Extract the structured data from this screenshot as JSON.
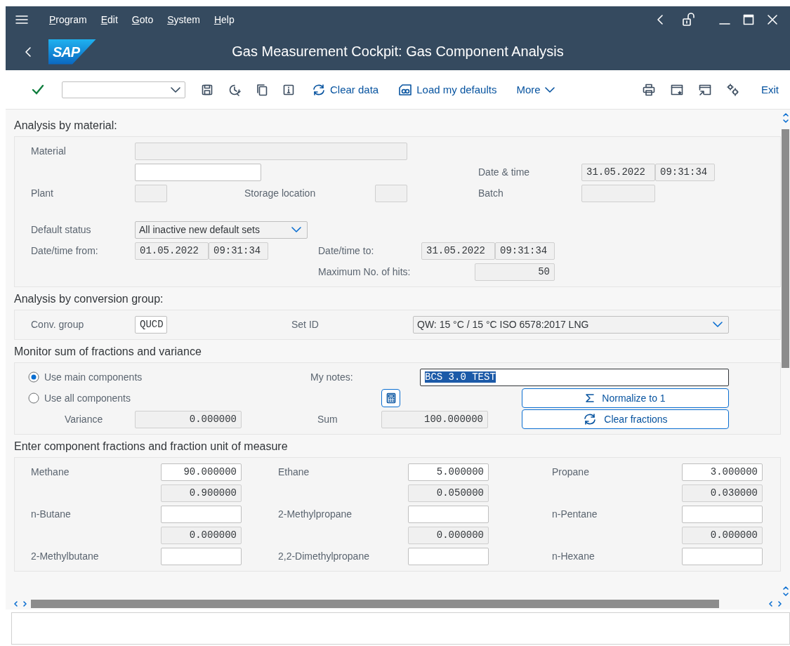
{
  "menu_bar": {
    "items": [
      {
        "label": "Program"
      },
      {
        "label": "Edit"
      },
      {
        "label": "Goto"
      },
      {
        "label": "System"
      },
      {
        "label": "Help"
      }
    ]
  },
  "title_bar": {
    "logo": "SAP",
    "title": "Gas Measurement Cockpit: Gas Component Analysis"
  },
  "toolbar": {
    "buttons": [
      {
        "label": "Clear data"
      },
      {
        "label": "Load my defaults"
      },
      {
        "label": "More"
      }
    ],
    "exit": "Exit"
  },
  "sections": [
    {
      "title": "Analysis by material:",
      "fields": [
        {
          "kind": "input",
          "label": "Material",
          "inputs": [
            {
              "kind": "field",
              "read_only": true
            }
          ]
        },
        {
          "kind": "input",
          "inputs": [
            {
              "kind": "field",
              "read_only": false
            }
          ]
        },
        {
          "kind": "input",
          "label": "Date & time",
          "inputs": [
            {
              "kind": "field",
              "read_only": true,
              "value": "31.05.2022"
            },
            {
              "kind": "field",
              "read_only": true,
              "value": "09:31:34"
            }
          ]
        },
        {
          "kind": "input",
          "label": "Plant",
          "inputs": [
            {
              "kind": "field",
              "read_only": true
            }
          ]
        },
        {
          "kind": "input",
          "label": "Storage location",
          "inputs": [
            {
              "kind": "field",
              "read_only": true
            }
          ]
        },
        {
          "kind": "input",
          "label": "Batch",
          "inputs": [
            {
              "kind": "field",
              "read_only": true
            }
          ]
        },
        {
          "kind": "input",
          "label": "Default status",
          "inputs": [
            {
              "kind": "dropdown",
              "value": "All inactive new default sets"
            }
          ]
        },
        {
          "kind": "input",
          "label": "Date/time from:",
          "inputs": [
            {
              "kind": "field",
              "read_only": true,
              "value": "01.05.2022"
            },
            {
              "kind": "field",
              "read_only": true,
              "value": "09:31:34"
            }
          ]
        },
        {
          "kind": "input",
          "label": "Date/time to:",
          "inputs": [
            {
              "kind": "field",
              "read_only": true,
              "value": "31.05.2022"
            },
            {
              "kind": "field",
              "read_only": true,
              "value": "09:31:34"
            }
          ]
        },
        {
          "kind": "input",
          "label": "Maximum No. of hits:",
          "inputs": [
            {
              "kind": "field",
              "read_only": true,
              "value": "50"
            }
          ]
        }
      ]
    },
    {
      "title": "Analysis by conversion group:",
      "fields": [
        {
          "kind": "input",
          "label": "Conv. group",
          "inputs": [
            {
              "kind": "field",
              "read_only": false,
              "value": "QUCD"
            }
          ]
        },
        {
          "kind": "input",
          "label": "Set ID",
          "inputs": [
            {
              "kind": "dropdown",
              "value": "QW: 15 °C / 15 °C ISO 6578:2017 LNG"
            }
          ]
        }
      ]
    },
    {
      "title": "Monitor sum of fractions and variance",
      "fields": [
        {
          "kind": "radio",
          "label": "Use main components",
          "selected": true
        },
        {
          "kind": "input",
          "label": "My notes:",
          "inputs": [
            {
              "kind": "field",
              "read_only": false,
              "value": "BCS 3.0 TEST",
              "focused": true
            }
          ]
        },
        {
          "kind": "radio",
          "label": "Use all components",
          "selected": false
        },
        {
          "kind": "icon_button"
        },
        {
          "kind": "button",
          "label": "Normalize to 1"
        },
        {
          "kind": "input",
          "label": "Variance",
          "inputs": [
            {
              "kind": "field",
              "read_only": true,
              "value": "0.000000"
            }
          ]
        },
        {
          "kind": "input",
          "label": "Sum",
          "inputs": [
            {
              "kind": "field",
              "read_only": true,
              "value": "100.000000"
            }
          ]
        },
        {
          "kind": "button",
          "label": "Clear fractions"
        }
      ]
    },
    {
      "title": "Enter component fractions and fraction unit of measure",
      "components": [
        {
          "label": "Methane",
          "value": "90.000000",
          "fraction": "0.900000"
        },
        {
          "label": "Ethane",
          "value": "5.000000",
          "fraction": "0.050000"
        },
        {
          "label": "Propane",
          "value": "3.000000",
          "fraction": "0.030000"
        },
        {
          "label": "n-Butane",
          "fraction": "0.000000"
        },
        {
          "label": "2-Methylpropane",
          "fraction": "0.000000"
        },
        {
          "label": "n-Pentane",
          "fraction": "0.000000"
        },
        {
          "label": "2-Methylbutane"
        },
        {
          "label": "2,2-Dimethylpropane"
        },
        {
          "label": "n-Hexane"
        }
      ]
    }
  ]
}
